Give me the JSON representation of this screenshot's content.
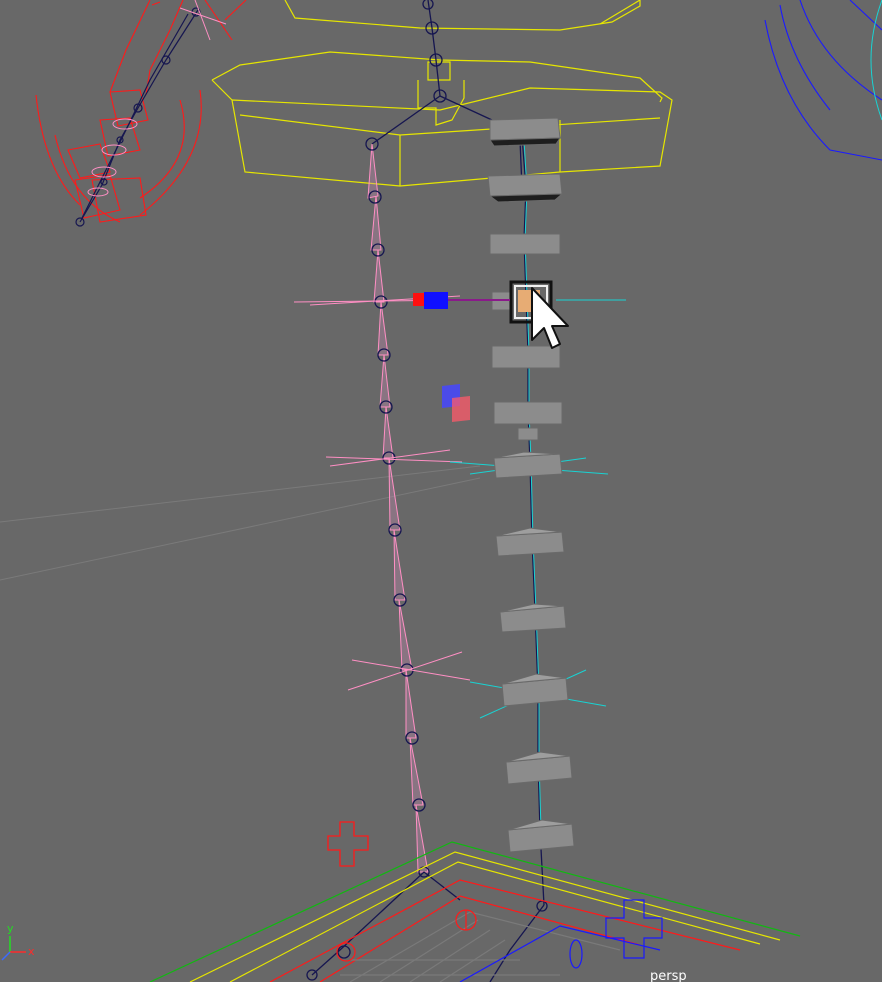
{
  "viewport": {
    "camera_name": "persp",
    "background_color": "#686868"
  },
  "axis_gizmo": {
    "x_label": "x",
    "y_label": "y",
    "x_color": "#ff2a2a",
    "y_color": "#22dd22",
    "z_color": "#3b6bff"
  },
  "scene": {
    "left_joint_chain_count": 15,
    "right_block_chain_count": 13,
    "colors": {
      "skin_yellow": "#e6e600",
      "arm_red": "#ff1a1a",
      "joint_navy": "#161650",
      "joint_pink": "#ff8fc4",
      "bone_cyan": "#19d3d3",
      "control_blue": "#1a1aff",
      "block_gray": "#8c8c8c",
      "selected_orange": "#e7ac74",
      "ground_green": "#11b811"
    }
  },
  "cursor": {
    "icon": "arrow-cursor-icon"
  }
}
